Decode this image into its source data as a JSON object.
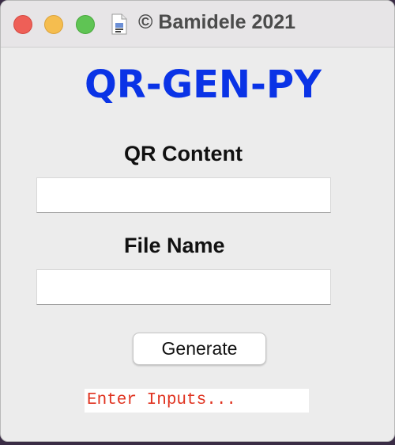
{
  "window": {
    "title": "© Bamidele 2021",
    "icon": "document-icon"
  },
  "app": {
    "heading": "QR-GEN-PY",
    "heading_color": "#0a33e6"
  },
  "form": {
    "content_label": "QR Content",
    "content_value": "",
    "file_label": "File Name",
    "file_value": "",
    "generate_label": "Generate"
  },
  "status": {
    "text": "Enter Inputs...",
    "color": "#e03320"
  }
}
